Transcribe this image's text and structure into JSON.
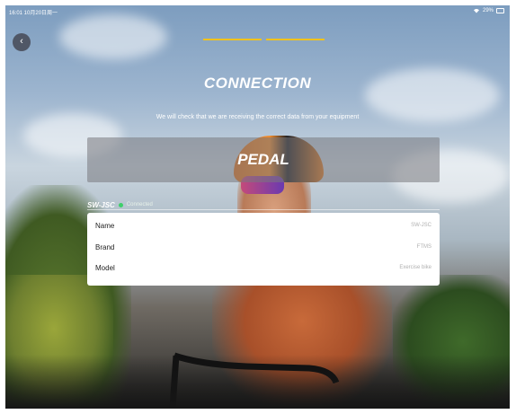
{
  "status_bar": {
    "time_date": "16:01 10月20日周一",
    "signal_battery": "29%"
  },
  "header": {
    "title": "CONNECTION",
    "subtitle": "We will check that we are receiving the correct data from your equipment"
  },
  "progress": {
    "steps_total": 2,
    "steps_completed": 2,
    "color": "#f2c21b"
  },
  "equipment": {
    "type_label": "PEDAL"
  },
  "device": {
    "name": "SW-JSC",
    "status": "Connected",
    "status_color": "#3ecf6a"
  },
  "details": [
    {
      "label": "Name",
      "value": "SW-JSC"
    },
    {
      "label": "Brand",
      "value": "FTMS"
    },
    {
      "label": "Model",
      "value": "Exercise bike"
    }
  ],
  "icons": {
    "back": "chevron-left-icon",
    "wifi": "wifi-icon",
    "battery": "battery-icon",
    "status_dot": "connected-dot-icon"
  }
}
